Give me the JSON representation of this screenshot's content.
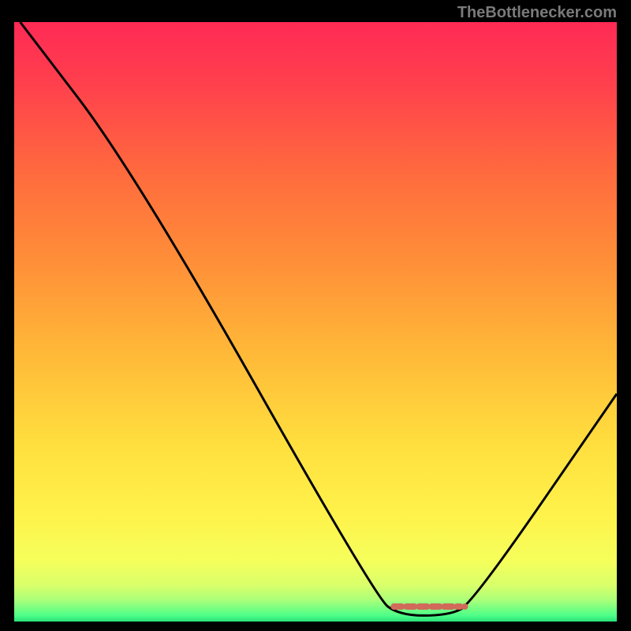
{
  "attribution": "TheBottlenecker.com",
  "chart_data": {
    "type": "line",
    "title": "",
    "xlabel": "",
    "ylabel": "",
    "xlim": [
      0,
      100
    ],
    "ylim": [
      0,
      100
    ],
    "series": [
      {
        "name": "curve",
        "points": [
          {
            "x": 1,
            "y": 100
          },
          {
            "x": 20,
            "y": 75
          },
          {
            "x": 60,
            "y": 4
          },
          {
            "x": 64,
            "y": 1
          },
          {
            "x": 72,
            "y": 1
          },
          {
            "x": 76,
            "y": 3
          },
          {
            "x": 100,
            "y": 38
          }
        ]
      }
    ],
    "marker": {
      "x_start": 63,
      "x_end": 74,
      "y": 2.5,
      "color": "#d16a5a"
    },
    "gradient_stops": [
      {
        "offset": 0.0,
        "color": "#ff2a55"
      },
      {
        "offset": 0.1,
        "color": "#ff3f4d"
      },
      {
        "offset": 0.25,
        "color": "#ff6a3e"
      },
      {
        "offset": 0.4,
        "color": "#ff8f38"
      },
      {
        "offset": 0.55,
        "color": "#ffb838"
      },
      {
        "offset": 0.7,
        "color": "#ffde3e"
      },
      {
        "offset": 0.82,
        "color": "#fff24a"
      },
      {
        "offset": 0.9,
        "color": "#f5ff5c"
      },
      {
        "offset": 0.94,
        "color": "#d8ff6a"
      },
      {
        "offset": 0.965,
        "color": "#a8ff7a"
      },
      {
        "offset": 0.99,
        "color": "#4dff88"
      },
      {
        "offset": 1.0,
        "color": "#28e078"
      }
    ]
  }
}
